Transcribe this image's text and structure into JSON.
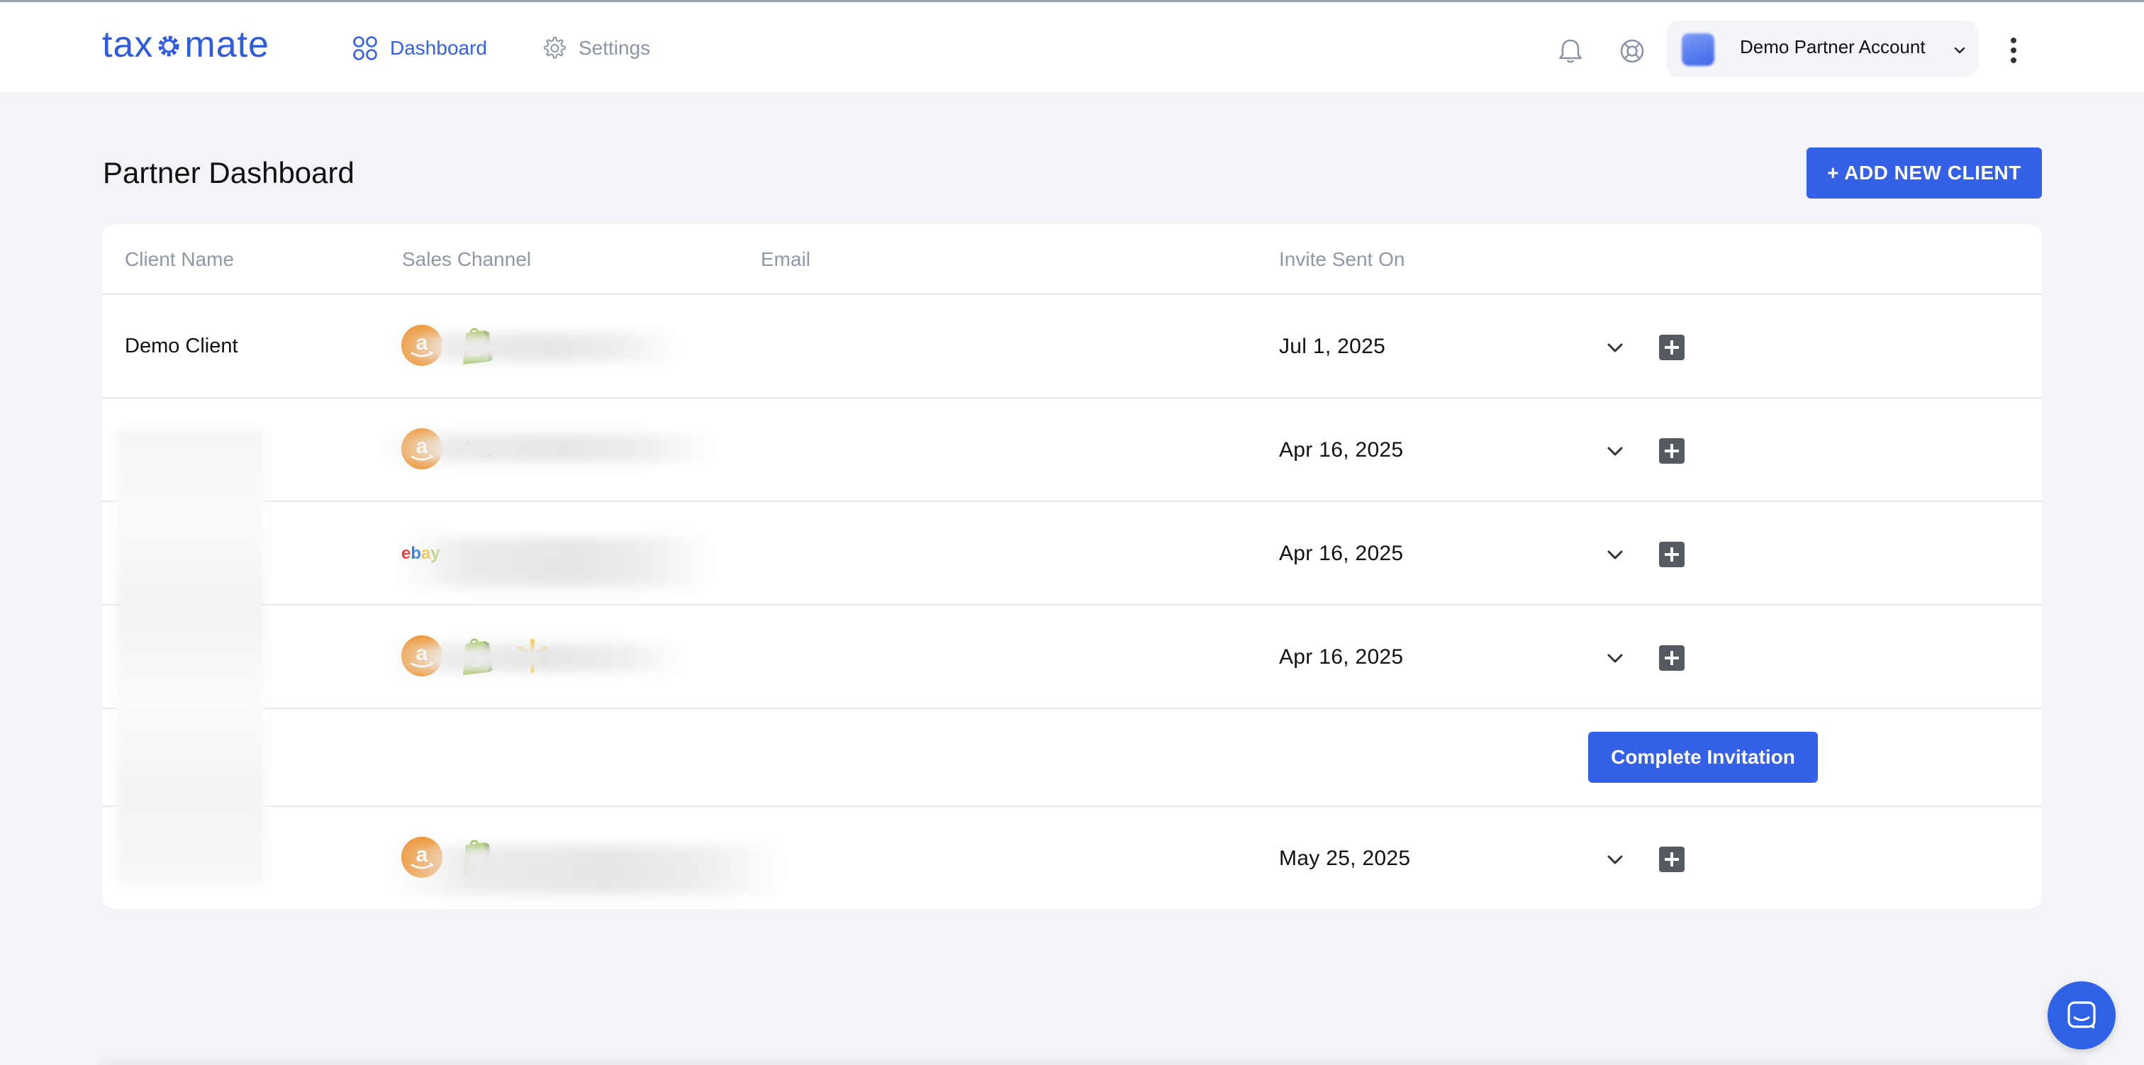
{
  "header": {
    "logo_text": "taxomate",
    "nav": [
      {
        "label": "Dashboard",
        "icon": "grid-icon",
        "active": true
      },
      {
        "label": "Settings",
        "icon": "gear-icon",
        "active": false
      }
    ],
    "account_name": "Demo Partner Account",
    "icons": [
      "bell-icon",
      "help-lifebuoy-icon",
      "chevron-down-icon",
      "kebab-menu-icon"
    ]
  },
  "page": {
    "title": "Partner Dashboard",
    "add_button_label": "+ ADD NEW CLIENT"
  },
  "table": {
    "columns": [
      "Client Name",
      "Sales Channel",
      "Email",
      "Invite Sent On"
    ],
    "rows": [
      {
        "client_name": "Demo Client",
        "channels": [
          "amazon",
          "shopify"
        ],
        "invite_sent_on": "Jul 1, 2025"
      },
      {
        "client_name": "",
        "channels": [
          "amazon",
          "ebay"
        ],
        "invite_sent_on": "Apr 16, 2025"
      },
      {
        "client_name": "",
        "channels": [
          "ebay"
        ],
        "invite_sent_on": "Apr 16, 2025"
      },
      {
        "client_name": "",
        "channels": [
          "amazon",
          "shopify",
          "walmart"
        ],
        "invite_sent_on": "Apr 16, 2025"
      },
      {
        "client_name": "",
        "channels": [],
        "invite_sent_on": "",
        "action_label": "Complete Invitation"
      },
      {
        "client_name": "",
        "channels": [
          "amazon",
          "shopify"
        ],
        "invite_sent_on": "May 25, 2025"
      }
    ]
  },
  "colors": {
    "brand": "#3560e8",
    "background": "#f3f4f7",
    "amazon": "#ef9a3c",
    "shopify": "#95bf47",
    "walmart": "#ffc220",
    "muted_text": "#8f97a8"
  },
  "chat_launcher_icon": "chat-bubble-icon"
}
